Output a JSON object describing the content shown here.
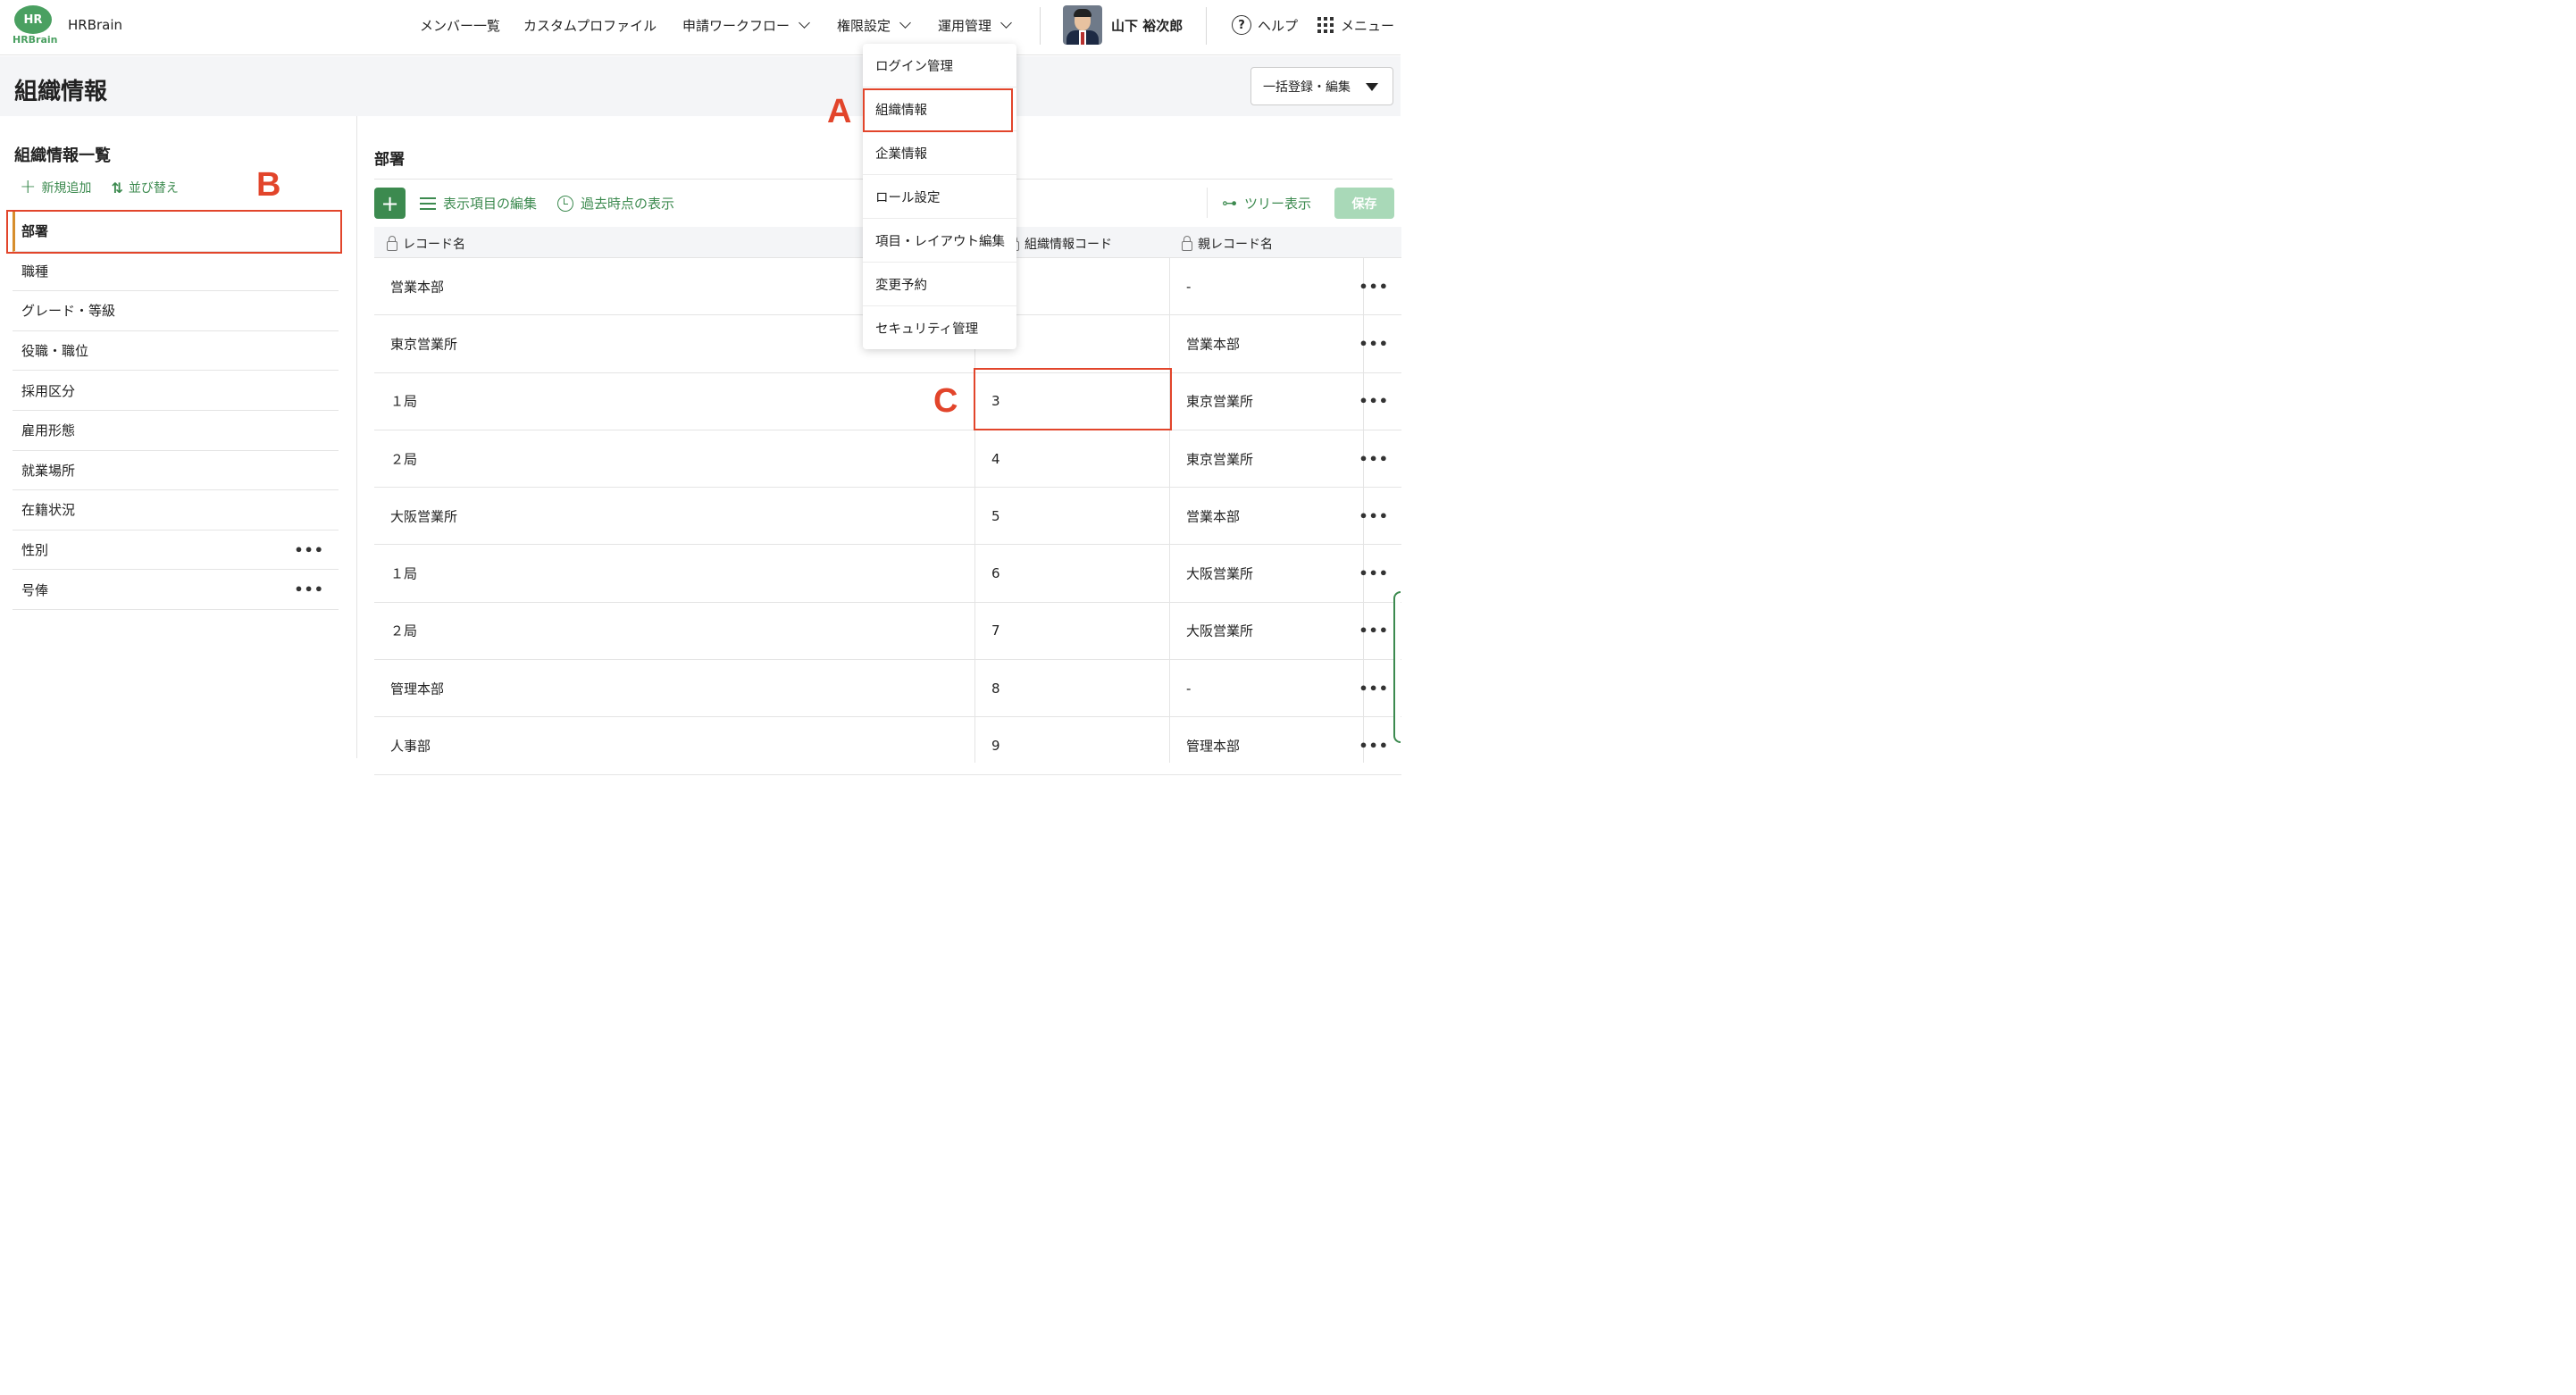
{
  "app": {
    "logo_mark": "HR",
    "logo_word": "HRBrain",
    "name": "HRBrain"
  },
  "nav": {
    "members": "メンバー一覧",
    "custom_profile": "カスタムプロファイル",
    "workflow": "申請ワークフロー",
    "permissions": "権限設定",
    "operations": "運用管理"
  },
  "user": {
    "name": "山下 裕次郎"
  },
  "help": {
    "icon_glyph": "?",
    "label": "ヘルプ"
  },
  "menu": {
    "label": "メニュー"
  },
  "page": {
    "title": "組織情報",
    "bulk_button": "一括登録・編集"
  },
  "left": {
    "title": "組織情報一覧",
    "add_label": "新規追加",
    "sort_label": "並び替え",
    "items": [
      {
        "label": "部署"
      },
      {
        "label": "職種"
      },
      {
        "label": "グレード・等級"
      },
      {
        "label": "役職・職位"
      },
      {
        "label": "採用区分"
      },
      {
        "label": "雇用形態"
      },
      {
        "label": "就業場所"
      },
      {
        "label": "在籍状況"
      },
      {
        "label": "性別"
      },
      {
        "label": "号俸"
      }
    ]
  },
  "main": {
    "section_title": "部署",
    "edit_columns": "表示項目の編集",
    "past_view": "過去時点の表示",
    "tree_view": "ツリー表示",
    "save": "保存",
    "columns": {
      "record_name": "レコード名",
      "code": "組織情報コード",
      "parent": "親レコード名"
    },
    "rows": [
      {
        "name": "営業本部",
        "code": "",
        "parent": "-"
      },
      {
        "name": "東京営業所",
        "code": "",
        "parent": "営業本部"
      },
      {
        "name": "１局",
        "code": "3",
        "parent": "東京営業所"
      },
      {
        "name": "２局",
        "code": "4",
        "parent": "東京営業所"
      },
      {
        "name": "大阪営業所",
        "code": "5",
        "parent": "営業本部"
      },
      {
        "name": "１局",
        "code": "6",
        "parent": "大阪営業所"
      },
      {
        "name": "２局",
        "code": "7",
        "parent": "大阪営業所"
      },
      {
        "name": "管理本部",
        "code": "8",
        "parent": "-"
      },
      {
        "name": "人事部",
        "code": "9",
        "parent": "管理本部"
      }
    ]
  },
  "dropdown": {
    "items": [
      {
        "label": "ログイン管理"
      },
      {
        "label": "組織情報"
      },
      {
        "label": "企業情報"
      },
      {
        "label": "ロール設定"
      },
      {
        "label": "項目・レイアウト編集"
      },
      {
        "label": "変更予約"
      },
      {
        "label": "セキュリティ管理"
      }
    ]
  },
  "annotations": {
    "a": "A",
    "b": "B",
    "c": "C"
  },
  "colors": {
    "brand_green": "#3c8a4f",
    "annotation_red": "#e2452b",
    "active_marker": "#d78e2d"
  },
  "icons": [
    "chevron-down-icon",
    "help-icon",
    "grid-icon",
    "plus-icon",
    "sort-icon",
    "list-icon",
    "clock-icon",
    "tree-icon",
    "lock-icon",
    "more-icon"
  ]
}
